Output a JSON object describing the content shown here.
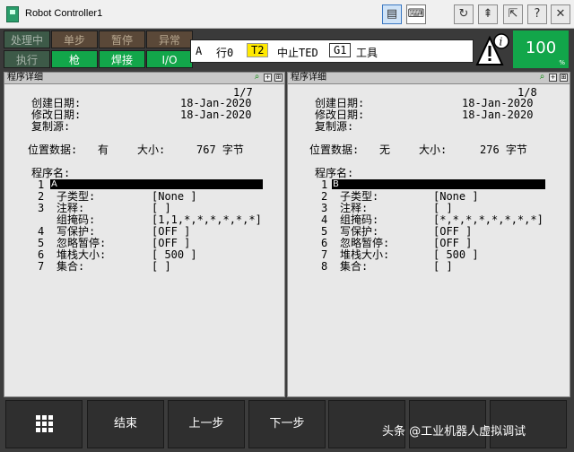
{
  "window": {
    "title": "Robot Controller1",
    "buttons": [
      "monitor-icon",
      "keyboard-icon",
      "refresh-icon",
      "jog-icon",
      "share-icon",
      "help-icon",
      "close-icon"
    ]
  },
  "status": {
    "lamps": [
      "处理中",
      "单步",
      "暂停",
      "异常",
      "执行",
      "枪",
      "焊接",
      "I/O"
    ],
    "mode": "A",
    "line": "行0",
    "t2": "T2",
    "stop": "中止TED",
    "group": "G1",
    "tool": "工具",
    "override": "100"
  },
  "left": {
    "title": "程序详细",
    "page": "1/7",
    "created_label": "创建日期:",
    "created": "18-Jan-2020",
    "modified_label": "修改日期:",
    "modified": "18-Jan-2020",
    "copy_label": "复制源:",
    "pos_label": "位置数据:",
    "pos_value": "有",
    "size_label": "大小:",
    "size_value": "767 字节",
    "prog_label": "程序名:",
    "prog_name": "A",
    "rows": [
      {
        "num": "1",
        "label": "",
        "value": ""
      },
      {
        "num": "2",
        "label": "子类型:",
        "value": "[None           ]"
      },
      {
        "num": "3",
        "label": "注释:",
        "value": "[               ]"
      },
      {
        "num": "",
        "label": "组掩码:",
        "value": "[1,1,*,*,*,*,*,*]"
      },
      {
        "num": "4",
        "label": "写保护:",
        "value": "[OFF            ]"
      },
      {
        "num": "5",
        "label": "忽略暂停:",
        "value": "[OFF            ]"
      },
      {
        "num": "6",
        "label": "堆栈大小:",
        "value": "[     500       ]"
      },
      {
        "num": "7",
        "label": "集合:",
        "value": "[               ]"
      }
    ]
  },
  "right": {
    "title": "程序详细",
    "page": "1/8",
    "created_label": "创建日期:",
    "created": "18-Jan-2020",
    "modified_label": "修改日期:",
    "modified": "18-Jan-2020",
    "copy_label": "复制源:",
    "pos_label": "位置数据:",
    "pos_value": "无",
    "size_label": "大小:",
    "size_value": "276 字节",
    "prog_label": "程序名:",
    "prog_name": "B",
    "rows": [
      {
        "num": "1",
        "label": "",
        "value": ""
      },
      {
        "num": "2",
        "label": "子类型:",
        "value": "[None           ]"
      },
      {
        "num": "3",
        "label": "注释:",
        "value": "[               ]"
      },
      {
        "num": "4",
        "label": "组掩码:",
        "value": "[*,*,*,*,*,*,*,*]"
      },
      {
        "num": "5",
        "label": "写保护:",
        "value": "[OFF            ]"
      },
      {
        "num": "6",
        "label": "忽略暂停:",
        "value": "[OFF            ]"
      },
      {
        "num": "7",
        "label": "堆栈大小:",
        "value": "[     500       ]"
      },
      {
        "num": "8",
        "label": "集合:",
        "value": "[               ]"
      }
    ]
  },
  "softkeys": [
    "结束",
    "上一步",
    "下一步",
    "",
    "",
    ""
  ],
  "watermark": "头条 @工业机器人虚拟调试"
}
